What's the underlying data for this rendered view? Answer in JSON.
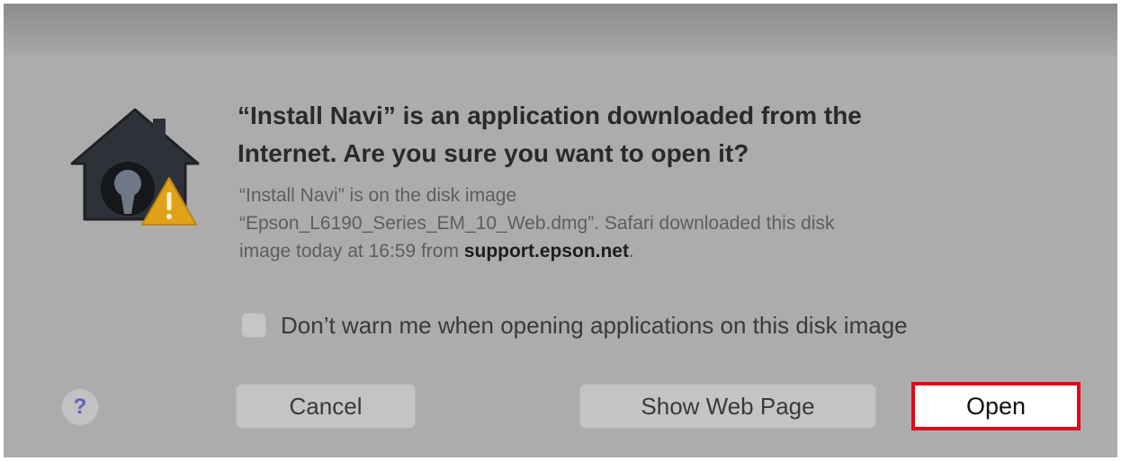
{
  "dialog": {
    "icon": "gatekeeper-warning-icon",
    "headline_lines": [
      "“Install Navi” is an application downloaded from the",
      "Internet. Are you sure you want to open it?"
    ],
    "detail": {
      "line1": "“Install Navi” is on the disk image",
      "line2": "“Epson_L6190_Series_EM_10_Web.dmg”. Safari downloaded this disk",
      "line3_prefix": "image today at 16:59 from ",
      "line3_source": "support.epson.net",
      "line3_suffix": "."
    },
    "checkbox": {
      "label": "Don’t warn me when opening applications on this disk image",
      "checked": false
    },
    "help_label": "?",
    "buttons": {
      "cancel": "Cancel",
      "show_web_page": "Show Web Page",
      "open": "Open"
    },
    "colors": {
      "highlight_border": "#e2061a",
      "warning_yellow": "#e0a21a"
    }
  }
}
